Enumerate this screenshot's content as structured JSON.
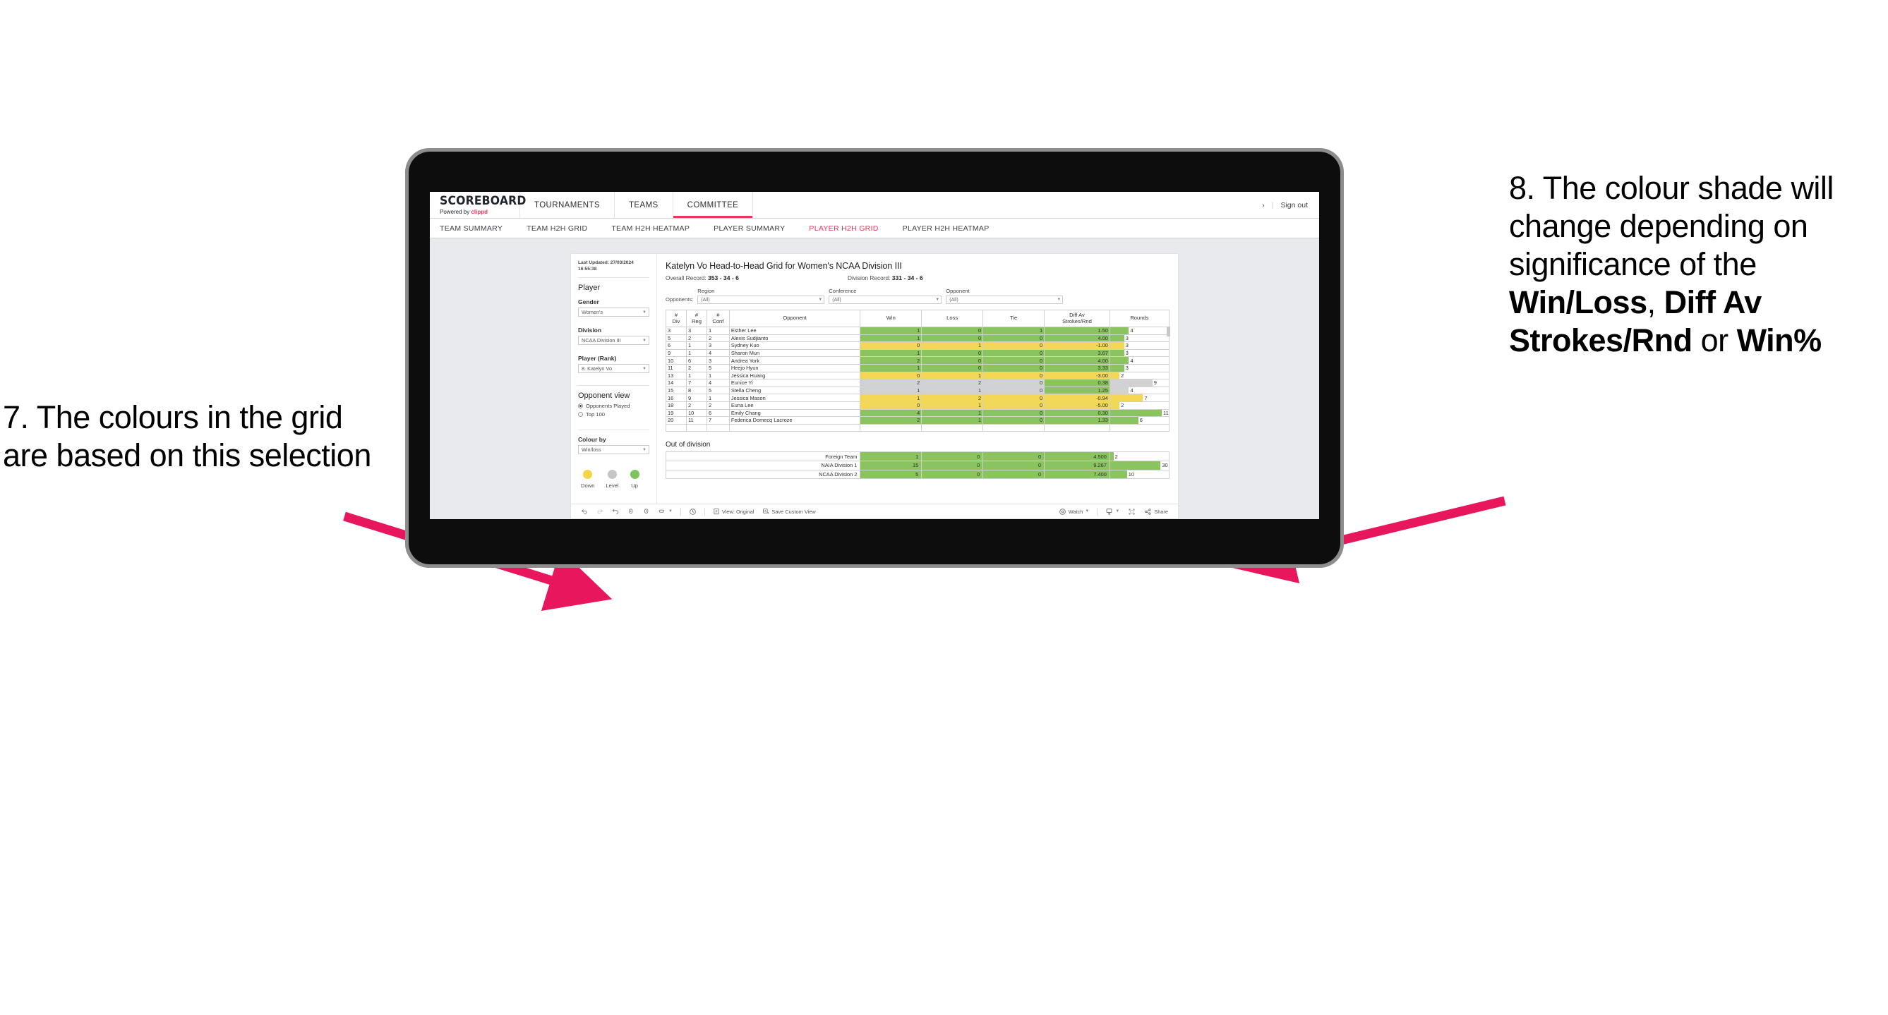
{
  "annotations": {
    "left": "7. The colours in the grid are based on this selection",
    "right_pre": "8. The colour shade will change depending on significance of the ",
    "right_b1": "Win/Loss",
    "right_mid1": ", ",
    "right_b2": "Diff Av Strokes/Rnd",
    "right_mid2": " or ",
    "right_b3": "Win%",
    "arrow_color": "#e8175d"
  },
  "app": {
    "brand": {
      "title": "SCOREBOARD",
      "powered_prefix": "Powered by ",
      "powered_name": "clippd"
    },
    "nav": [
      {
        "label": "TOURNAMENTS",
        "active": false
      },
      {
        "label": "TEAMS",
        "active": false
      },
      {
        "label": "COMMITTEE",
        "active": true
      }
    ],
    "top_right": {
      "chevron": "›",
      "divider": "|",
      "sign_out": "Sign out"
    },
    "subnav": [
      {
        "label": "TEAM SUMMARY",
        "active": false
      },
      {
        "label": "TEAM H2H GRID",
        "active": false
      },
      {
        "label": "TEAM H2H HEATMAP",
        "active": false
      },
      {
        "label": "PLAYER SUMMARY",
        "active": false
      },
      {
        "label": "PLAYER H2H GRID",
        "active": true
      },
      {
        "label": "PLAYER H2H HEATMAP",
        "active": false
      }
    ],
    "accent": "#e8375a"
  },
  "sidebar": {
    "last_updated": "Last Updated: 27/03/2024 16:55:38",
    "heading": "Player",
    "gender": {
      "label": "Gender",
      "value": "Women's"
    },
    "division": {
      "label": "Division",
      "value": "NCAA Division III"
    },
    "player_rank": {
      "label": "Player (Rank)",
      "value": "8. Katelyn Vo"
    },
    "opponent_view": {
      "heading": "Opponent view",
      "options": [
        {
          "label": "Opponents Played",
          "selected": true
        },
        {
          "label": "Top 100",
          "selected": false
        }
      ]
    },
    "colour_by": {
      "label": "Colour by",
      "value": "Win/loss"
    },
    "legend": [
      {
        "label": "Down",
        "color": "#f5d547"
      },
      {
        "label": "Level",
        "color": "#c3c6c9"
      },
      {
        "label": "Up",
        "color": "#7dc45c"
      }
    ]
  },
  "main": {
    "title": "Katelyn Vo Head-to-Head Grid for Women's NCAA Division III",
    "overall_record_label": "Overall Record: ",
    "overall_record_value": "353 -  34 - 6",
    "division_record_label": "Division Record: ",
    "division_record_value": "331 -  34 - 6",
    "opponents_label": "Opponents:",
    "filters": [
      {
        "label": "Region",
        "value": "(All)"
      },
      {
        "label": "Conference",
        "value": "(All)"
      },
      {
        "label": "Opponent",
        "value": "(All)"
      }
    ]
  },
  "chart_data": {
    "type": "table",
    "title": "Katelyn Vo Head-to-Head Grid for Women's NCAA Division III",
    "columns": [
      "# Div",
      "# Reg",
      "# Conf",
      "Opponent",
      "Win",
      "Loss",
      "Tie",
      "Diff Av Strokes/Rnd",
      "Rounds"
    ],
    "column_headers_multiline": [
      [
        "#",
        "Div"
      ],
      [
        "#",
        "Reg"
      ],
      [
        "#",
        "Conf"
      ],
      [
        "Opponent"
      ],
      [
        "Win"
      ],
      [
        "Loss"
      ],
      [
        "Tie"
      ],
      [
        "Diff Av",
        "Strokes/Rnd"
      ],
      [
        "Rounds"
      ]
    ],
    "rows": [
      {
        "div": "3",
        "reg": "3",
        "conf": "1",
        "opponent": "Esther Lee",
        "win": "1",
        "loss": "0",
        "tie": "1",
        "diff": "1.50",
        "rounds": "4",
        "rounds_n": 4,
        "shade": "up"
      },
      {
        "div": "5",
        "reg": "2",
        "conf": "2",
        "opponent": "Alexis Sudjianto",
        "win": "1",
        "loss": "0",
        "tie": "0",
        "diff": "4.00",
        "rounds": "3",
        "rounds_n": 3,
        "shade": "up"
      },
      {
        "div": "6",
        "reg": "1",
        "conf": "3",
        "opponent": "Sydney Kuo",
        "win": "0",
        "loss": "1",
        "tie": "0",
        "diff": "-1.00",
        "rounds": "3",
        "rounds_n": 3,
        "shade": "down"
      },
      {
        "div": "9",
        "reg": "1",
        "conf": "4",
        "opponent": "Sharon Mun",
        "win": "1",
        "loss": "0",
        "tie": "0",
        "diff": "3.67",
        "rounds": "3",
        "rounds_n": 3,
        "shade": "up"
      },
      {
        "div": "10",
        "reg": "6",
        "conf": "3",
        "opponent": "Andrea York",
        "win": "2",
        "loss": "0",
        "tie": "0",
        "diff": "4.00",
        "rounds": "4",
        "rounds_n": 4,
        "shade": "up"
      },
      {
        "div": "11",
        "reg": "2",
        "conf": "5",
        "opponent": "Heejo Hyun",
        "win": "1",
        "loss": "0",
        "tie": "0",
        "diff": "3.33",
        "rounds": "3",
        "rounds_n": 3,
        "shade": "up"
      },
      {
        "div": "13",
        "reg": "1",
        "conf": "1",
        "opponent": "Jessica Huang",
        "win": "0",
        "loss": "1",
        "tie": "0",
        "diff": "-3.00",
        "rounds": "2",
        "rounds_n": 2,
        "shade": "down"
      },
      {
        "div": "14",
        "reg": "7",
        "conf": "4",
        "opponent": "Eunice Yi",
        "win": "2",
        "loss": "2",
        "tie": "0",
        "diff": "0.38",
        "rounds": "9",
        "rounds_n": 9,
        "shade": "level",
        "diff_shade": "up"
      },
      {
        "div": "15",
        "reg": "8",
        "conf": "5",
        "opponent": "Stella Cheng",
        "win": "1",
        "loss": "1",
        "tie": "0",
        "diff": "1.25",
        "rounds": "4",
        "rounds_n": 4,
        "shade": "level",
        "diff_shade": "up"
      },
      {
        "div": "16",
        "reg": "9",
        "conf": "1",
        "opponent": "Jessica Mason",
        "win": "1",
        "loss": "2",
        "tie": "0",
        "diff": "-0.94",
        "rounds": "7",
        "rounds_n": 7,
        "shade": "down"
      },
      {
        "div": "18",
        "reg": "2",
        "conf": "2",
        "opponent": "Euna Lee",
        "win": "0",
        "loss": "1",
        "tie": "0",
        "diff": "-5.00",
        "rounds": "2",
        "rounds_n": 2,
        "shade": "down"
      },
      {
        "div": "19",
        "reg": "10",
        "conf": "6",
        "opponent": "Emily Chang",
        "win": "4",
        "loss": "1",
        "tie": "0",
        "diff": "0.30",
        "rounds": "11",
        "rounds_n": 11,
        "shade": "up"
      },
      {
        "div": "20",
        "reg": "11",
        "conf": "7",
        "opponent": "Federica Domecq Lacroze",
        "win": "2",
        "loss": "1",
        "tie": "0",
        "diff": "1.33",
        "rounds": "6",
        "rounds_n": 6,
        "shade": "up"
      }
    ],
    "rounds_max": 11,
    "out_of_division": {
      "title": "Out of division",
      "rows": [
        {
          "name": "Foreign Team",
          "win": "1",
          "loss": "0",
          "tie": "0",
          "diff": "4.500",
          "rounds": "2",
          "rounds_n": 2,
          "shade": "up"
        },
        {
          "name": "NAIA Division 1",
          "win": "15",
          "loss": "0",
          "tie": "0",
          "diff": "9.267",
          "rounds": "30",
          "rounds_n": 30,
          "shade": "up"
        },
        {
          "name": "NCAA Division 2",
          "win": "5",
          "loss": "0",
          "tie": "0",
          "diff": "7.400",
          "rounds": "10",
          "rounds_n": 10,
          "shade": "up"
        }
      ],
      "rounds_max": 30
    },
    "colors": {
      "up": "#8ac45e",
      "down": "#f5d756",
      "level": "#d0d2d4",
      "none": "#ffffff"
    }
  },
  "toolbar": {
    "undo": "undo-icon",
    "redo": "redo-icon",
    "revert": "revert-icon",
    "refresh": "refresh-icon",
    "pause": "pause-icon",
    "alerts": "alerts-icon",
    "clock": "clock-icon",
    "view_label": "View: Original",
    "save_label": "Save Custom View",
    "watch_label": "Watch",
    "subscribe": "subscribe-icon",
    "fullscreen": "fullscreen-icon",
    "share_label": "Share"
  }
}
